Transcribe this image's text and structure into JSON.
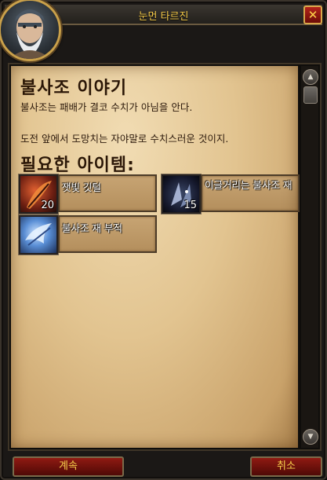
{
  "window": {
    "title": "눈먼 타르진",
    "close_glyph": "✕"
  },
  "quest": {
    "title": "불사조 이야기",
    "description_lines": [
      "불사조는 패배가 결코 수치가 아님을 안다.",
      "도전 앞에서 도망치는 자야말로 수치스러운 것이지."
    ]
  },
  "required_items": {
    "heading": "필요한 아이템:",
    "items": [
      {
        "name": "잿빛 깃털",
        "count": "20",
        "icon": "ash-feather-icon"
      },
      {
        "name": "이글거리는 불사조 재",
        "count": "15",
        "icon": "smoldering-ash-icon"
      },
      {
        "name": "불사조 재 부적",
        "count": "",
        "icon": "ash-talisman-icon"
      }
    ]
  },
  "footer": {
    "continue_label": "계속",
    "cancel_label": "취소"
  },
  "colors": {
    "title_gold": "#f4c94a",
    "button_red": "#8f1a12",
    "parchment": "#e2c490"
  }
}
